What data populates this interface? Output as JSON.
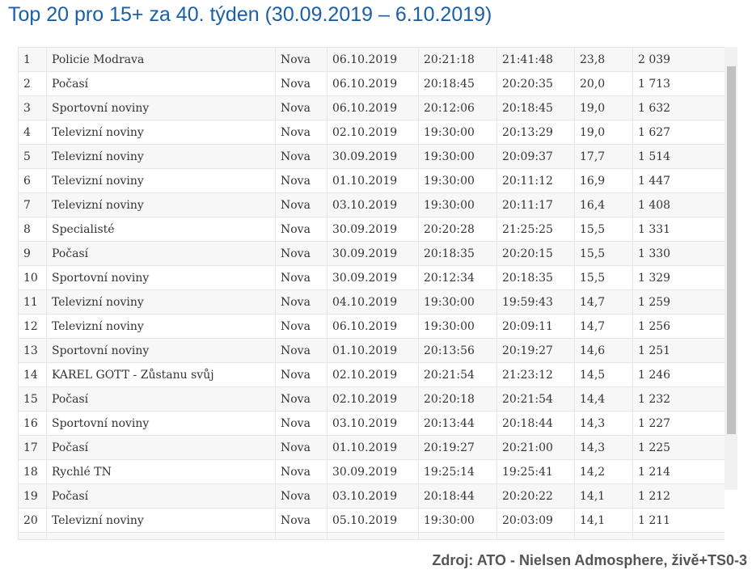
{
  "title": "Top 20 pro 15+ za 40. týden (30.09.2019 – 6.10.2019)",
  "source": "Zdroj: ATO - Nielsen Admosphere, živě+TS0-3",
  "rows": [
    {
      "rank": "1",
      "program": "Policie Modrava",
      "channel": "Nova",
      "date": "06.10.2019",
      "start": "20:21:18",
      "end": "21:41:48",
      "rating": "23,8",
      "viewers": "2 039"
    },
    {
      "rank": "2",
      "program": "Počasí",
      "channel": "Nova",
      "date": "06.10.2019",
      "start": "20:18:45",
      "end": "20:20:35",
      "rating": "20,0",
      "viewers": "1 713"
    },
    {
      "rank": "3",
      "program": "Sportovní noviny",
      "channel": "Nova",
      "date": "06.10.2019",
      "start": "20:12:06",
      "end": "20:18:45",
      "rating": "19,0",
      "viewers": "1 632"
    },
    {
      "rank": "4",
      "program": "Televizní noviny",
      "channel": "Nova",
      "date": "02.10.2019",
      "start": "19:30:00",
      "end": "20:13:29",
      "rating": "19,0",
      "viewers": "1 627"
    },
    {
      "rank": "5",
      "program": "Televizní noviny",
      "channel": "Nova",
      "date": "30.09.2019",
      "start": "19:30:00",
      "end": "20:09:37",
      "rating": "17,7",
      "viewers": "1 514"
    },
    {
      "rank": "6",
      "program": "Televizní noviny",
      "channel": "Nova",
      "date": "01.10.2019",
      "start": "19:30:00",
      "end": "20:11:12",
      "rating": "16,9",
      "viewers": "1 447"
    },
    {
      "rank": "7",
      "program": "Televizní noviny",
      "channel": "Nova",
      "date": "03.10.2019",
      "start": "19:30:00",
      "end": "20:11:17",
      "rating": "16,4",
      "viewers": "1 408"
    },
    {
      "rank": "8",
      "program": "Specialisté",
      "channel": "Nova",
      "date": "30.09.2019",
      "start": "20:20:28",
      "end": "21:25:25",
      "rating": "15,5",
      "viewers": "1 331"
    },
    {
      "rank": "9",
      "program": "Počasí",
      "channel": "Nova",
      "date": "30.09.2019",
      "start": "20:18:35",
      "end": "20:20:15",
      "rating": "15,5",
      "viewers": "1 330"
    },
    {
      "rank": "10",
      "program": "Sportovní noviny",
      "channel": "Nova",
      "date": "30.09.2019",
      "start": "20:12:34",
      "end": "20:18:35",
      "rating": "15,5",
      "viewers": "1 329"
    },
    {
      "rank": "11",
      "program": "Televizní noviny",
      "channel": "Nova",
      "date": "04.10.2019",
      "start": "19:30:00",
      "end": "19:59:43",
      "rating": "14,7",
      "viewers": "1 259"
    },
    {
      "rank": "12",
      "program": "Televizní noviny",
      "channel": "Nova",
      "date": "06.10.2019",
      "start": "19:30:00",
      "end": "20:09:11",
      "rating": "14,7",
      "viewers": "1 256"
    },
    {
      "rank": "13",
      "program": "Sportovní noviny",
      "channel": "Nova",
      "date": "01.10.2019",
      "start": "20:13:56",
      "end": "20:19:27",
      "rating": "14,6",
      "viewers": "1 251"
    },
    {
      "rank": "14",
      "program": "KAREL GOTT - Zůstanu svůj",
      "channel": "Nova",
      "date": "02.10.2019",
      "start": "20:21:54",
      "end": "21:23:12",
      "rating": "14,5",
      "viewers": "1 246"
    },
    {
      "rank": "15",
      "program": "Počasí",
      "channel": "Nova",
      "date": "02.10.2019",
      "start": "20:20:18",
      "end": "20:21:54",
      "rating": "14,4",
      "viewers": "1 232"
    },
    {
      "rank": "16",
      "program": "Sportovní noviny",
      "channel": "Nova",
      "date": "03.10.2019",
      "start": "20:13:44",
      "end": "20:18:44",
      "rating": "14,3",
      "viewers": "1 227"
    },
    {
      "rank": "17",
      "program": "Počasí",
      "channel": "Nova",
      "date": "01.10.2019",
      "start": "20:19:27",
      "end": "20:21:00",
      "rating": "14,3",
      "viewers": "1 225"
    },
    {
      "rank": "18",
      "program": "Rychlé TN",
      "channel": "Nova",
      "date": "30.09.2019",
      "start": "19:25:14",
      "end": "19:25:41",
      "rating": "14,2",
      "viewers": "1 214"
    },
    {
      "rank": "19",
      "program": "Počasí",
      "channel": "Nova",
      "date": "03.10.2019",
      "start": "20:18:44",
      "end": "20:20:22",
      "rating": "14,1",
      "viewers": "1 212"
    },
    {
      "rank": "20",
      "program": "Televizní noviny",
      "channel": "Nova",
      "date": "05.10.2019",
      "start": "19:30:00",
      "end": "20:03:09",
      "rating": "14,1",
      "viewers": "1 211"
    }
  ]
}
